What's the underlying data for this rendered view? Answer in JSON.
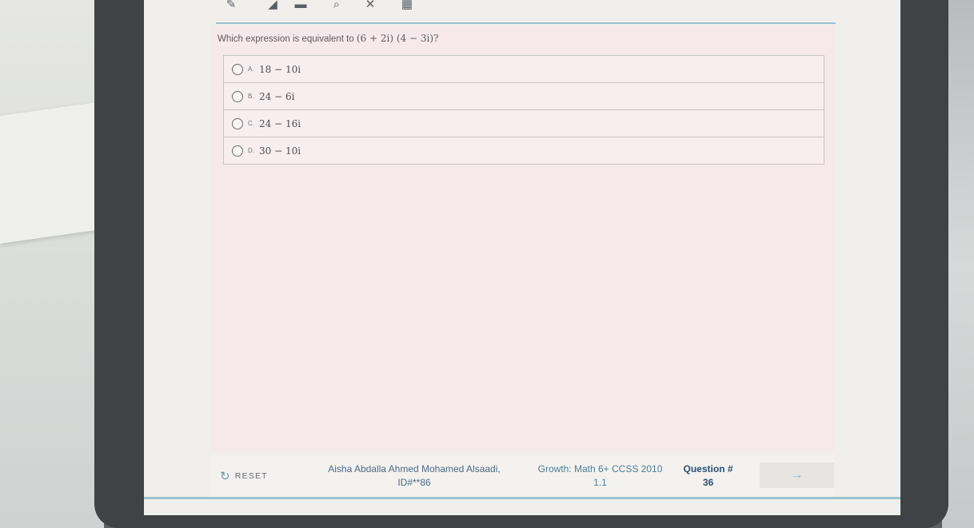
{
  "toolbar": {
    "tools": [
      {
        "name": "pencil-icon",
        "glyph": "✎"
      },
      {
        "name": "highlighter-icon",
        "glyph": "◢"
      },
      {
        "name": "line-reader-icon",
        "glyph": "▬"
      },
      {
        "name": "magnifier-icon",
        "glyph": "⌕"
      },
      {
        "name": "eliminator-icon",
        "glyph": "✕"
      },
      {
        "name": "calculator-icon",
        "glyph": "▦"
      }
    ]
  },
  "question": {
    "prompt": "Which expression is equivalent to",
    "expression": "(6 + 2i) (4 − 3i)?",
    "choices": [
      {
        "letter": "A.",
        "expr": "18 − 10i"
      },
      {
        "letter": "B.",
        "expr": "24 − 6i"
      },
      {
        "letter": "C.",
        "expr": "24 − 16i"
      },
      {
        "letter": "D.",
        "expr": "30 − 10i"
      }
    ]
  },
  "footer": {
    "reset_label": "RESET",
    "student_name": "Aisha Abdalla Ahmed Mohamed Alsaadi,",
    "student_id": "ID#**86",
    "test_name": "Growth: Math 6+ CCSS 2010",
    "test_version": "1.1",
    "question_label": "Question #",
    "question_number": "36",
    "next_glyph": "→"
  }
}
